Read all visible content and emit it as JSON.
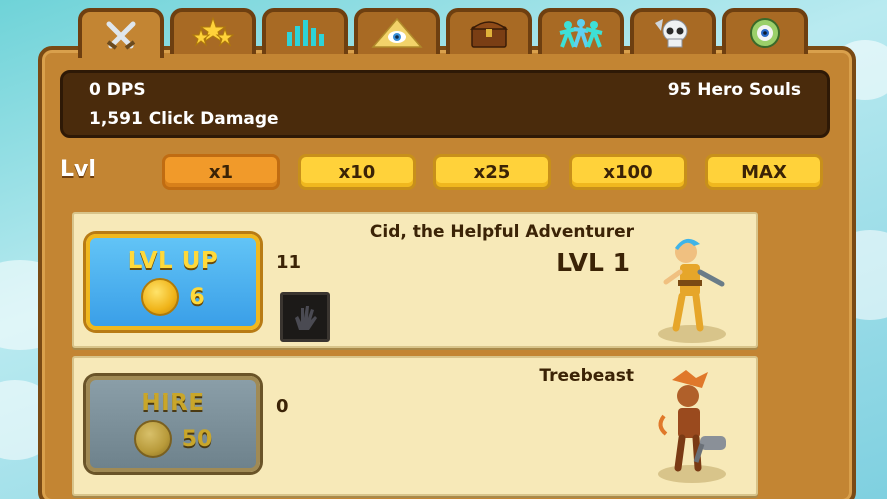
{
  "tabs": [
    {
      "icon": "crossed-swords-icon",
      "active": true
    },
    {
      "icon": "stars-icon",
      "active": false
    },
    {
      "icon": "bar-chart-icon",
      "active": false
    },
    {
      "icon": "eye-pyramid-icon",
      "active": false
    },
    {
      "icon": "treasure-chest-icon",
      "active": false
    },
    {
      "icon": "mercenaries-icon",
      "active": false
    },
    {
      "icon": "skull-icon",
      "active": false
    },
    {
      "icon": "eyeball-icon",
      "active": false
    }
  ],
  "stats": {
    "dps": "0 DPS",
    "click_damage": "1,591 Click Damage",
    "hero_souls": "95 Hero Souls"
  },
  "level_bar": {
    "label": "Lvl",
    "multipliers": [
      "x1",
      "x10",
      "x25",
      "x100",
      "MAX"
    ],
    "selected": "x1"
  },
  "heroes": [
    {
      "name": "Cid, the Helpful Adventurer",
      "level": "LVL 1",
      "action": "LVL UP",
      "cost": "6",
      "dps": "11",
      "portrait": "cid-portrait"
    },
    {
      "name": "Treebeast",
      "level": "",
      "action": "HIRE",
      "cost": "50",
      "dps": "0",
      "portrait": "treebeast-portrait"
    }
  ],
  "colors": {
    "panel": "#c38533",
    "stat_bar": "#4a2b0c",
    "multiplier": "#ffd23a",
    "multiplier_selected": "#f19a2a",
    "card": "#f7e9b8",
    "levelup_button": "#3a9fe8",
    "hire_button_disabled": "#6e828c"
  }
}
